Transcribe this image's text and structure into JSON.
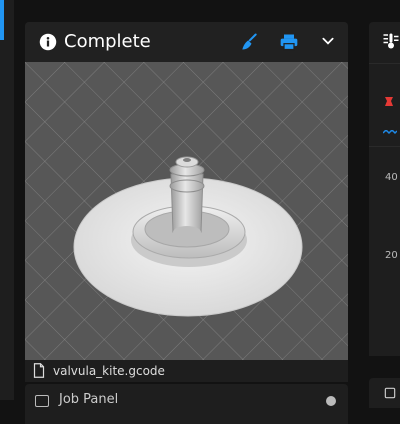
{
  "status_card": {
    "title": "Complete",
    "icons": [
      "info-icon",
      "brush-icon",
      "print-icon",
      "chevron-down-icon"
    ],
    "accent_color": "#2196f3"
  },
  "thumbnail": {
    "alt": "valvula_kite.gcode"
  },
  "file": {
    "name": "valvula_kite.gcode"
  },
  "job_panel": {
    "label": "Job Panel"
  },
  "temperature": {
    "ticks": [
      "40",
      "20"
    ],
    "colors": {
      "heater": "#e53935",
      "sensor": "#1e88e5"
    }
  }
}
